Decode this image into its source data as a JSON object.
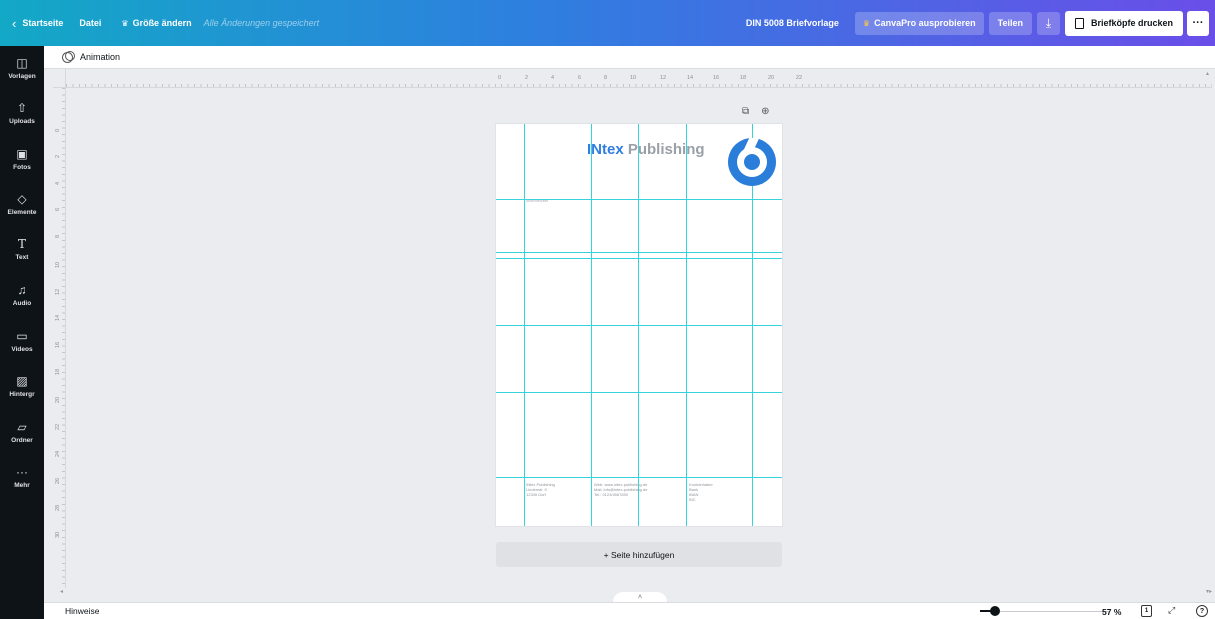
{
  "topbar": {
    "home_label": "Startseite",
    "file_label": "Datei",
    "resize_label": "Größe ändern",
    "saved_status": "Alle Änderungen gespeichert",
    "doc_title": "DIN 5008 Briefvorlage",
    "pro_label": "CanvaPro ausprobieren",
    "share_label": "Teilen",
    "print_label": "Briefköpfe drucken",
    "more_label": "···"
  },
  "sidebar": {
    "items": [
      {
        "label": "Vorlagen",
        "icon": "layout-icon"
      },
      {
        "label": "Uploads",
        "icon": "upload-icon"
      },
      {
        "label": "Fotos",
        "icon": "photo-icon"
      },
      {
        "label": "Elemente",
        "icon": "elements-icon"
      },
      {
        "label": "Text",
        "icon": "text-icon"
      },
      {
        "label": "Audio",
        "icon": "music-icon"
      },
      {
        "label": "Videos",
        "icon": "video-icon"
      },
      {
        "label": "Hintergr",
        "icon": "background-icon"
      },
      {
        "label": "Ordner",
        "icon": "folder-icon"
      },
      {
        "label": "Mehr",
        "icon": "more-icon"
      }
    ]
  },
  "subbar": {
    "animation_label": "Animation"
  },
  "ruler": {
    "top": [
      "0",
      "2",
      "4",
      "6",
      "8",
      "10",
      "12",
      "14",
      "16",
      "18",
      "20",
      "22"
    ],
    "left": [
      "0",
      "2",
      "4",
      "6",
      "8",
      "10",
      "12",
      "14",
      "16",
      "18",
      "20",
      "22",
      "24",
      "26",
      "28",
      "30"
    ]
  },
  "page": {
    "logo_word1": "INtex",
    "logo_word2": " Publishing",
    "address_line": "Absenderzeile",
    "footer": [
      [
        "INtex Publishing",
        "Lindenstr. 9",
        "12345 Dorf"
      ],
      [
        "Web: www.intex-publishing.de",
        "Mail: info@intex-publishing.de",
        "Tel.: 0123/4567890"
      ],
      [
        "Kontoinhaber",
        "Bank",
        "IBAN",
        "BIC"
      ]
    ]
  },
  "add_page_label": "+ Seite hinzufügen",
  "bottom": {
    "hint_label": "Hinweise",
    "zoom_value": "57 %",
    "zoom_fraction": 0.57,
    "page_count": "1"
  }
}
